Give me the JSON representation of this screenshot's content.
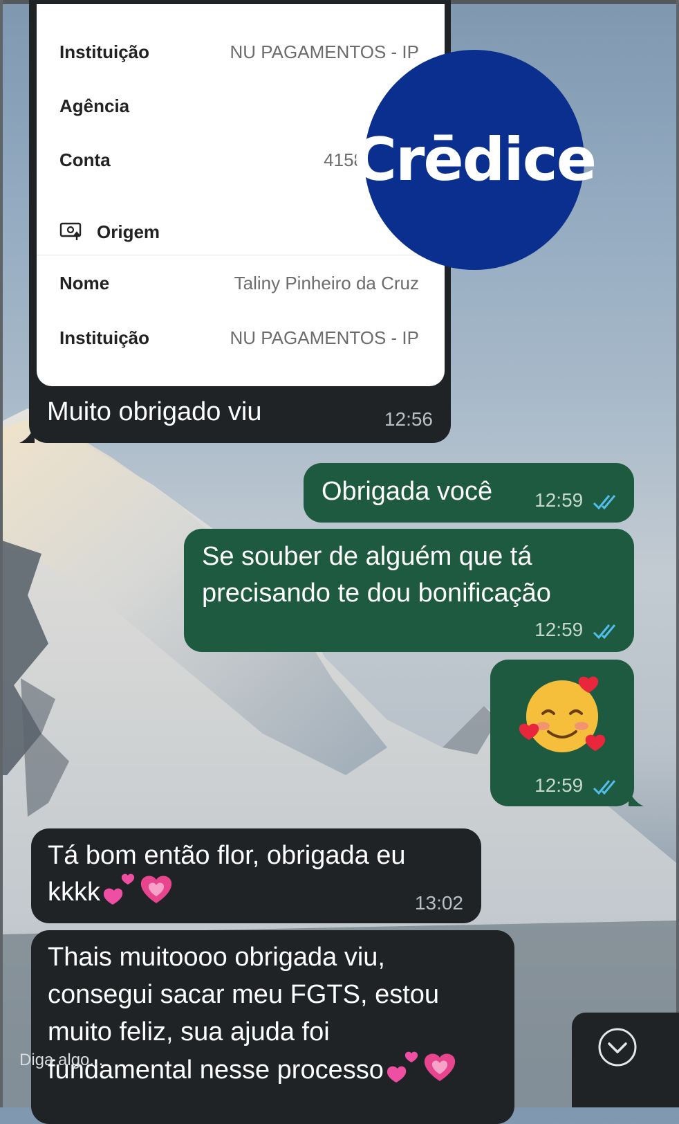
{
  "receipt": {
    "rows_top": [
      {
        "label": "Instituição",
        "value": "NU PAGAMENTOS - IP"
      },
      {
        "label": "Agência",
        "value": ""
      },
      {
        "label": "Conta",
        "value": "4158"
      }
    ],
    "origem_label": "Origem",
    "rows_bottom": [
      {
        "label": "Nome",
        "value": "Taliny Pinheiro da Cruz"
      },
      {
        "label": "Instituição",
        "value": "NU PAGAMENTOS - IP"
      }
    ]
  },
  "logo": {
    "text": "Crēdice",
    "color": "#0a2f8e"
  },
  "messages": [
    {
      "direction": "incoming",
      "text": "Muito obrigado viu",
      "time": "12:56"
    },
    {
      "direction": "outgoing",
      "text": "Obrigada você",
      "time": "12:59",
      "status": "read"
    },
    {
      "direction": "outgoing",
      "text_line1": "Se souber de alguém que tá",
      "text_line2": "precisando te dou bonificação",
      "time": "12:59",
      "status": "read"
    },
    {
      "direction": "outgoing",
      "emoji": "smiling-face-with-hearts",
      "time": "12:59",
      "status": "read"
    },
    {
      "direction": "incoming",
      "text_line1": "Tá bom então flor, obrigada eu",
      "text_line2": "kkkk",
      "time": "13:02"
    },
    {
      "direction": "incoming",
      "text_line1": "Thais muitoooo obrigada viu,",
      "text_line2": "consegui sacar meu FGTS, estou",
      "text_line3": "muito feliz, sua ajuda foi",
      "text_line4": "fundamental nesse processo"
    }
  ],
  "input": {
    "placeholder": "Diga algo..."
  },
  "colors": {
    "incoming_bubble": "#1f2326",
    "outgoing_bubble": "#1d5a40",
    "read_ticks": "#53bdeb"
  }
}
